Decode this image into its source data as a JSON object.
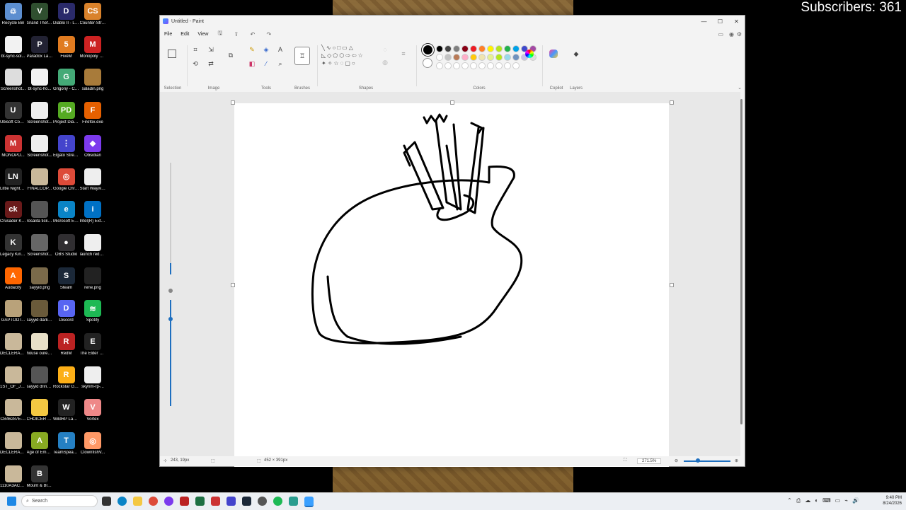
{
  "overlay": {
    "subscribers": "Subscribers: 361"
  },
  "desktop": {
    "icons": [
      {
        "label": "Recycle Bin",
        "color": "#5c8ecf",
        "glyph": "♲"
      },
      {
        "label": "Grand Theft Auto V Le...",
        "color": "#2f4f2f",
        "glyph": "V"
      },
      {
        "label": "Diablo II - Lord of D...",
        "color": "#2a2a6a",
        "glyph": "D"
      },
      {
        "label": "Counter-Str... 2",
        "color": "#d9822b",
        "glyph": "CS"
      },
      {
        "label": "bt-sync-sol...",
        "color": "#f2f2f2",
        "glyph": ""
      },
      {
        "label": "Paradox Launcher v2",
        "color": "#223",
        "glyph": "P"
      },
      {
        "label": "FiveM",
        "color": "#e07b20",
        "glyph": "5"
      },
      {
        "label": "Monopoly Plus",
        "color": "#c22",
        "glyph": "M"
      },
      {
        "label": "Screenshot...",
        "color": "#ddd",
        "glyph": ""
      },
      {
        "label": "bt-sync-ho...",
        "color": "#f2f2f2",
        "glyph": ""
      },
      {
        "label": "Grigoriy - Chrome",
        "color": "#4a7",
        "glyph": "G"
      },
      {
        "label": "saladin.png",
        "color": "#a87b3a",
        "glyph": ""
      },
      {
        "label": "Ubisoft Connect",
        "color": "#333",
        "glyph": "U"
      },
      {
        "label": "Screenshot...",
        "color": "#eee",
        "glyph": ""
      },
      {
        "label": "Project Diablo 2",
        "color": "#5a2",
        "glyph": "PD"
      },
      {
        "label": "Firefox.exe",
        "color": "#e66000",
        "glyph": "F"
      },
      {
        "label": "MONOPO...",
        "color": "#c33",
        "glyph": "M"
      },
      {
        "label": "Screenshot...",
        "color": "#eee",
        "glyph": ""
      },
      {
        "label": "Elgato Stream Deck",
        "color": "#4444cc",
        "glyph": "⋮"
      },
      {
        "label": "Obsidian",
        "color": "#7c3aed",
        "glyph": "◆"
      },
      {
        "label": "Little Nightmar...",
        "color": "#222",
        "glyph": "LN"
      },
      {
        "label": "FINALCOP...",
        "color": "#c9b89a",
        "glyph": ""
      },
      {
        "label": "Google Chrome",
        "color": "#dd4b39",
        "glyph": "◎"
      },
      {
        "label": "Start Waywar...",
        "color": "#eee",
        "glyph": ""
      },
      {
        "label": "Crusader Kings III",
        "color": "#6a1a1a",
        "glyph": "ck"
      },
      {
        "label": "rosalita ticket.png",
        "color": "#555",
        "glyph": ""
      },
      {
        "label": "Microsoft Edge",
        "color": "#0a84c6",
        "glyph": "e"
      },
      {
        "label": "Intel(R) Extre...",
        "color": "#0071c5",
        "glyph": "i"
      },
      {
        "label": "Legacy Kindle",
        "color": "#333",
        "glyph": "K"
      },
      {
        "label": "Screenshot...",
        "color": "#666",
        "glyph": ""
      },
      {
        "label": "OBS Studio",
        "color": "#302e31",
        "glyph": "●"
      },
      {
        "label": "launch redm.bat",
        "color": "#eee",
        "glyph": ""
      },
      {
        "label": "Audacity",
        "color": "#f60",
        "glyph": "A"
      },
      {
        "label": "sayyid.png",
        "color": "#7a6a4a",
        "glyph": ""
      },
      {
        "label": "Steam",
        "color": "#1b2838",
        "glyph": "S"
      },
      {
        "label": "rene.png",
        "color": "#222",
        "glyph": ""
      },
      {
        "label": "GAPTOOT...",
        "color": "#b9a27a",
        "glyph": ""
      },
      {
        "label": "sayyid darker.png",
        "color": "#6a5a3a",
        "glyph": ""
      },
      {
        "label": "Discord",
        "color": "#5865f2",
        "glyph": "D"
      },
      {
        "label": "Spotify",
        "color": "#1db954",
        "glyph": "≋"
      },
      {
        "label": "DECLERATI...",
        "color": "#c9b89a",
        "glyph": ""
      },
      {
        "label": "house oure.png",
        "color": "#e8e0c8",
        "glyph": ""
      },
      {
        "label": "RedM",
        "color": "#b22",
        "glyph": "R"
      },
      {
        "label": "The Elder Scrolls ...",
        "color": "#222",
        "glyph": "E"
      },
      {
        "label": "1ST_OF_JUL...",
        "color": "#c9b89a",
        "glyph": ""
      },
      {
        "label": "sayyid drinking ...",
        "color": "#555",
        "glyph": ""
      },
      {
        "label": "Rockstar Games ...",
        "color": "#fcaf17",
        "glyph": "R"
      },
      {
        "label": "skyrim-rp-...",
        "color": "#eee",
        "glyph": ""
      },
      {
        "label": "CB46287E-...",
        "color": "#c9b89a",
        "glyph": ""
      },
      {
        "label": "CHOICER VOICER",
        "color": "#f4c842",
        "glyph": ""
      },
      {
        "label": "WildRP Launcher",
        "color": "#222",
        "glyph": "W"
      },
      {
        "label": "Vortex",
        "color": "#e88",
        "glyph": "V"
      },
      {
        "label": "DECLERATI... FINAL.png",
        "color": "#c9b89a",
        "glyph": ""
      },
      {
        "label": "Age of Empires...",
        "color": "#8a2",
        "glyph": "A"
      },
      {
        "label": "TeamSpeak 3 Client",
        "color": "#2580c3",
        "glyph": "T"
      },
      {
        "label": "ClownfishV...",
        "color": "#f96",
        "glyph": "◎"
      },
      {
        "label": "1110A3ACS...",
        "color": "#c9b89a",
        "glyph": ""
      },
      {
        "label": "Mount & Blade II B...",
        "color": "#333",
        "glyph": "B"
      }
    ]
  },
  "window": {
    "title": "Untitled - Paint",
    "menu": [
      "File",
      "Edit",
      "View"
    ],
    "groups": {
      "selection": "Selection",
      "image": "Image",
      "tools": "Tools",
      "brushes": "Brushes",
      "shapes": "Shapes",
      "colors": "Colors",
      "copilot": "Copilot",
      "layers": "Layers"
    },
    "palette_row1": [
      "#000000",
      "#444444",
      "#7f7f7f",
      "#880015",
      "#ed1c24",
      "#ff7f27",
      "#fff200",
      "#b5e61d",
      "#22b14c",
      "#00a2e8",
      "#3f48cc",
      "#a349a4"
    ],
    "palette_row2": [
      "#ffffff",
      "#c3c3c3",
      "#b97a57",
      "#ffaec9",
      "#ffc90e",
      "#efe4b0",
      "#e6f090",
      "#b5e61d",
      "#99d9ea",
      "#7092be",
      "#c8bfe7",
      "#dddddd"
    ],
    "status": {
      "cursor": "243, 19px",
      "canvas_size": "452 × 391px",
      "zoom": "271.5%"
    }
  },
  "taskbar": {
    "search": "Search",
    "time": "9:40 PM",
    "date": "8/24/2026"
  }
}
